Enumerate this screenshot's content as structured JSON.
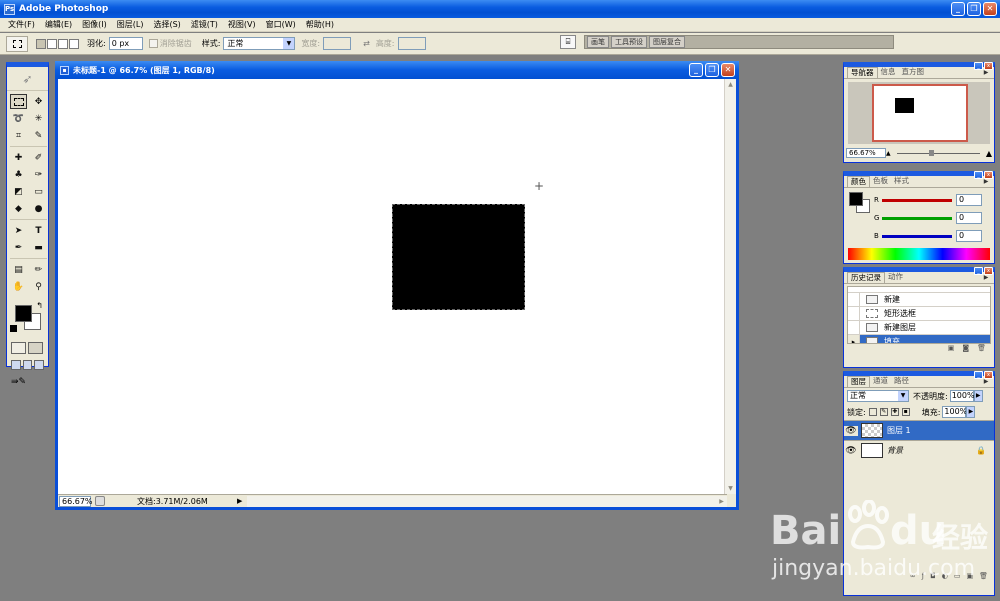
{
  "app": {
    "title": "Adobe Photoshop",
    "icon": "Ps"
  },
  "window_buttons": {
    "minimize": "_",
    "restore": "❐",
    "close": "✕"
  },
  "menubar": [
    "文件(F)",
    "编辑(E)",
    "图像(I)",
    "图层(L)",
    "选择(S)",
    "滤镜(T)",
    "视图(V)",
    "窗口(W)",
    "帮助(H)"
  ],
  "options": {
    "feather_label": "羽化:",
    "feather_value": "0 px",
    "antialias_label": "消除锯齿",
    "style_label": "样式:",
    "style_value": "正常",
    "width_label": "宽度:",
    "height_label": "高度:",
    "swap_glyph": "⇄"
  },
  "palette_well": {
    "tabs": [
      "画笔",
      "工具预设",
      "图层复合"
    ]
  },
  "document": {
    "title": "未标题-1 @ 66.7% (图层 1, RGB/8)",
    "zoom": "66.67%",
    "doc_info": "文档:3.71M/2.06M",
    "crosshair_glyph": "+"
  },
  "navigator": {
    "tabs": [
      "导航器",
      "信息",
      "直方图"
    ],
    "zoom": "66.67%",
    "zoom_out": "▲",
    "zoom_in": "▲"
  },
  "color_palette": {
    "tabs": [
      "颜色",
      "色板",
      "样式"
    ],
    "channels": [
      {
        "label": "R",
        "value": "0",
        "color": "#c00000"
      },
      {
        "label": "G",
        "value": "0",
        "color": "#00a000"
      },
      {
        "label": "B",
        "value": "0",
        "color": "#0000c0"
      }
    ]
  },
  "history": {
    "tabs": [
      "历史记录",
      "动作"
    ],
    "items": [
      "新建",
      "矩形选框",
      "新建图层",
      "填充"
    ],
    "selected_index": 3
  },
  "layers": {
    "tabs": [
      "图层",
      "通道",
      "路径"
    ],
    "blend_mode": "正常",
    "opacity_label": "不透明度:",
    "opacity": "100%",
    "lock_label": "锁定:",
    "fill_label": "填充:",
    "fill": "100%",
    "items": [
      {
        "name": "图层 1",
        "selected": true
      },
      {
        "name": "背景",
        "selected": false,
        "locked": true
      }
    ]
  },
  "watermark": {
    "brand": "Bai",
    "brand_tail": "du",
    "cn": "经验",
    "url": "jingyan.baidu.com"
  },
  "colors": {
    "accent_blue": "#0a5ce0",
    "panel_bg": "#ece9d8",
    "workspace_bg": "#7f7f7f",
    "selection": "#316ac5"
  }
}
